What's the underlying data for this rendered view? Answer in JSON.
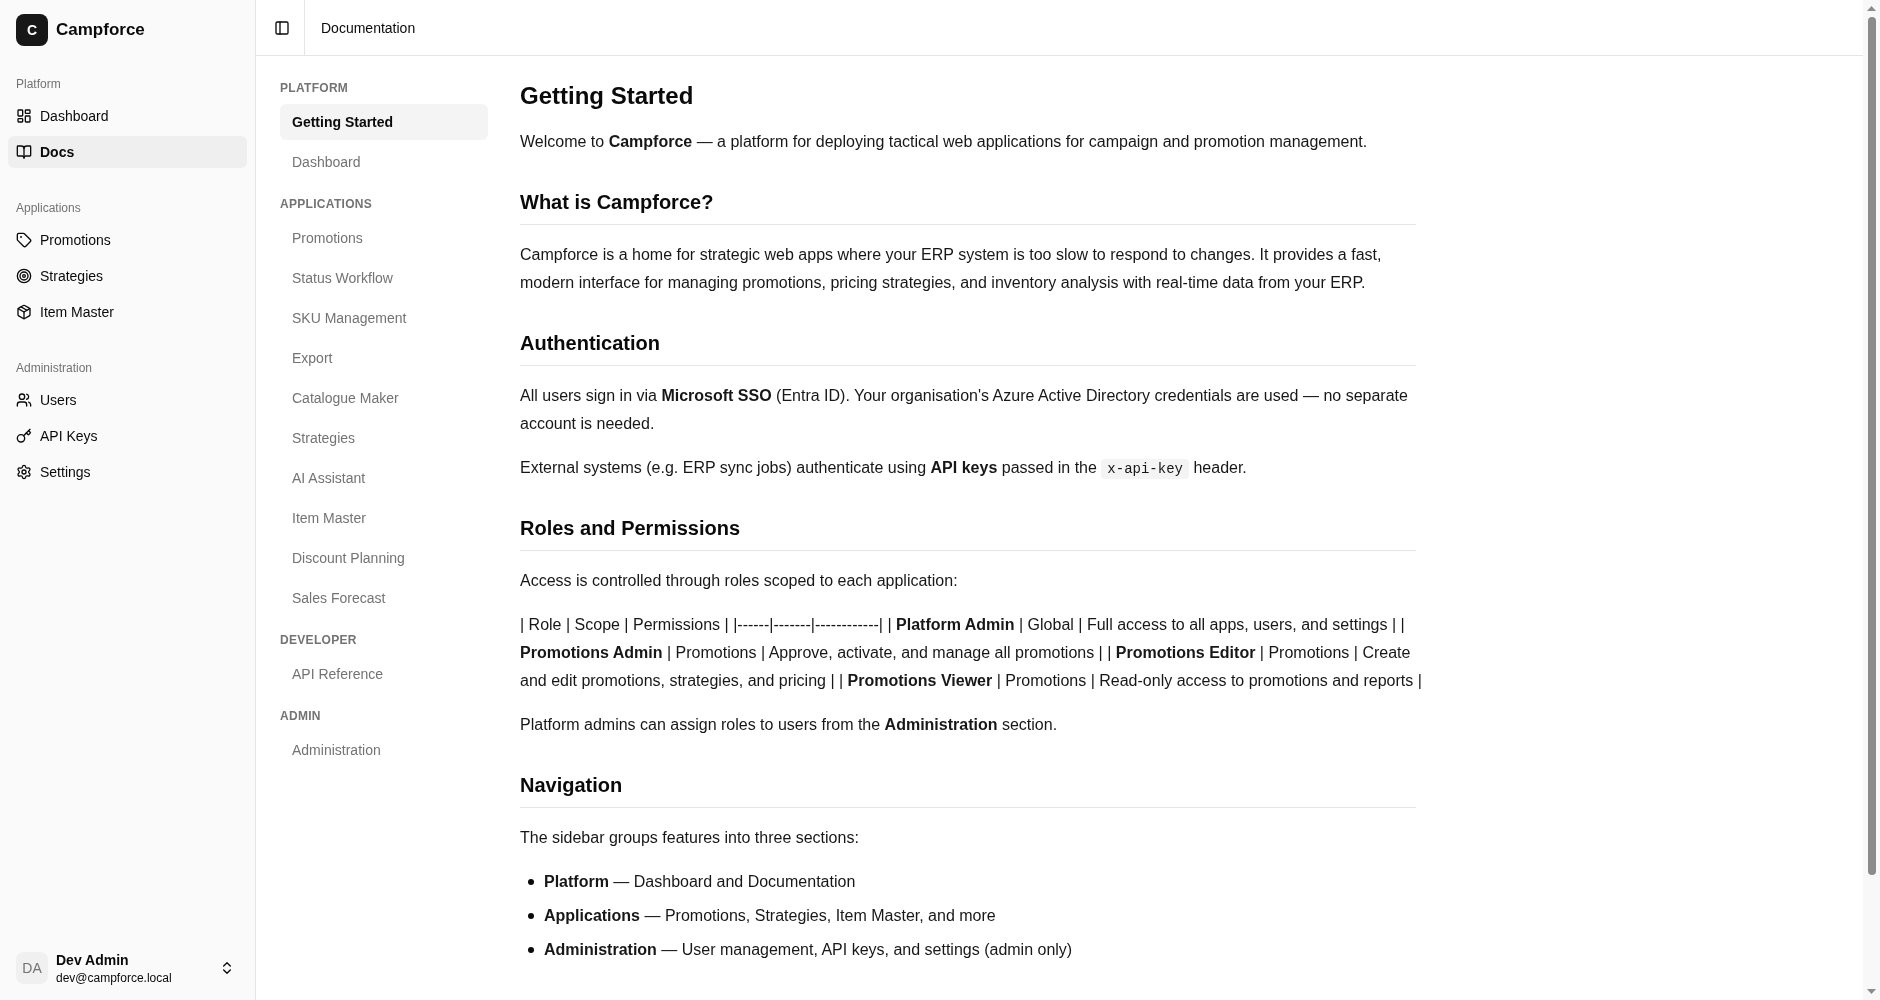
{
  "sidebar": {
    "brand": {
      "logo_letter": "C",
      "name": "Campforce"
    },
    "groups": [
      {
        "label": "Platform",
        "items": [
          {
            "label": "Dashboard",
            "selected": false
          },
          {
            "label": "Docs",
            "selected": true
          }
        ]
      },
      {
        "label": "Applications",
        "items": [
          {
            "label": "Promotions",
            "selected": false
          },
          {
            "label": "Strategies",
            "selected": false
          },
          {
            "label": "Item Master",
            "selected": false
          }
        ]
      },
      {
        "label": "Administration",
        "items": [
          {
            "label": "Users",
            "selected": false
          },
          {
            "label": "API Keys",
            "selected": false
          },
          {
            "label": "Settings",
            "selected": false
          }
        ]
      }
    ],
    "user": {
      "initials": "DA",
      "name": "Dev Admin",
      "email": "dev@campforce.local"
    }
  },
  "header": {
    "title": "Documentation"
  },
  "doc_nav": {
    "sections": [
      {
        "label": "PLATFORM",
        "items": [
          {
            "label": "Getting Started",
            "selected": true
          },
          {
            "label": "Dashboard",
            "selected": false
          }
        ]
      },
      {
        "label": "APPLICATIONS",
        "items": [
          {
            "label": "Promotions",
            "selected": false
          },
          {
            "label": "Status Workflow",
            "selected": false
          },
          {
            "label": "SKU Management",
            "selected": false
          },
          {
            "label": "Export",
            "selected": false
          },
          {
            "label": "Catalogue Maker",
            "selected": false
          },
          {
            "label": "Strategies",
            "selected": false
          },
          {
            "label": "AI Assistant",
            "selected": false
          },
          {
            "label": "Item Master",
            "selected": false
          },
          {
            "label": "Discount Planning",
            "selected": false
          },
          {
            "label": "Sales Forecast",
            "selected": false
          }
        ]
      },
      {
        "label": "DEVELOPER",
        "items": [
          {
            "label": "API Reference",
            "selected": false
          }
        ]
      },
      {
        "label": "ADMIN",
        "items": [
          {
            "label": "Administration",
            "selected": false
          }
        ]
      }
    ]
  },
  "article": {
    "blocks": [
      {
        "kind": "title",
        "text": "Getting Started"
      },
      {
        "kind": "paragraph",
        "text": "Welcome to **Campforce** — a platform for deploying tactical web applications for campaign and promotion management."
      },
      {
        "kind": "heading",
        "text": "What is Campforce?"
      },
      {
        "kind": "paragraph",
        "text": "Campforce is a home for strategic web apps where your ERP system is too slow to respond to changes. It provides a fast, modern interface for managing promotions, pricing strategies, and inventory analysis with real-time data from your ERP."
      },
      {
        "kind": "heading",
        "text": "Authentication"
      },
      {
        "kind": "paragraph",
        "text": "All users sign in via **Microsoft SSO** (Entra ID). Your organisation's Azure Active Directory credentials are used — no separate account is needed."
      },
      {
        "kind": "paragraph",
        "parts": [
          {
            "kind": "text",
            "text": "External systems (e.g. ERP sync jobs) authenticate using **API keys** passed in the "
          },
          {
            "kind": "code",
            "text": "x-api-key"
          },
          {
            "kind": "text",
            "text": " header."
          }
        ]
      },
      {
        "kind": "heading",
        "text": "Roles and Permissions"
      },
      {
        "kind": "paragraph",
        "text": "Access is controlled through roles scoped to each application:"
      },
      {
        "kind": "paragraph",
        "text": "| Role | Scope | Permissions | |------|-------|------------| | **Platform Admin** | Global | Full access to all apps, users, and settings | | **Promotions Admin** | Promotions | Approve, activate, and manage all promotions | | **Promotions Editor** | Promotions | Create and edit promotions, strategies, and pricing | | **Promotions Viewer** | Promotions | Read-only access to promotions and reports |"
      },
      {
        "kind": "paragraph",
        "text": "Platform admins can assign roles to users from the **Administration** section."
      },
      {
        "kind": "heading",
        "text": "Navigation"
      },
      {
        "kind": "paragraph",
        "text": "The sidebar groups features into three sections:"
      },
      {
        "kind": "list",
        "items": [
          "**Platform** — Dashboard and Documentation",
          "**Applications** — Promotions, Strategies, Item Master, and more",
          "**Administration** — User management, API keys, and settings (admin only)"
        ]
      }
    ]
  }
}
